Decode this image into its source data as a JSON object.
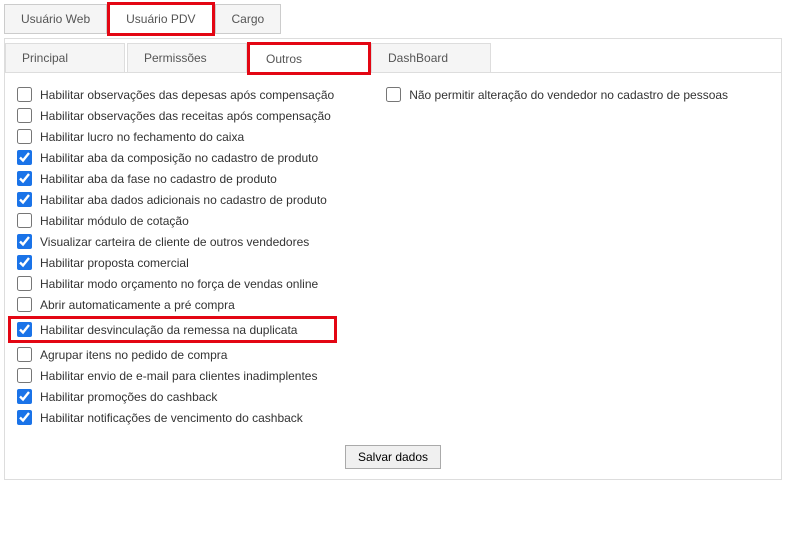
{
  "topTabs": [
    {
      "label": "Usuário Web",
      "active": false,
      "highlight": false
    },
    {
      "label": "Usuário PDV",
      "active": true,
      "highlight": true
    },
    {
      "label": "Cargo",
      "active": false,
      "highlight": false
    }
  ],
  "subTabs": [
    {
      "label": "Principal",
      "active": false,
      "highlight": false
    },
    {
      "label": "Permissões",
      "active": false,
      "highlight": false
    },
    {
      "label": "Outros",
      "active": true,
      "highlight": true
    },
    {
      "label": "DashBoard",
      "active": false,
      "highlight": false
    }
  ],
  "leftOptions": [
    {
      "label": "Habilitar observações das depesas após compensação",
      "checked": false,
      "highlight": false
    },
    {
      "label": "Habilitar observações das receitas após compensação",
      "checked": false,
      "highlight": false
    },
    {
      "label": "Habilitar lucro no fechamento do caixa",
      "checked": false,
      "highlight": false
    },
    {
      "label": "Habilitar aba da composição no cadastro de produto",
      "checked": true,
      "highlight": false
    },
    {
      "label": "Habilitar aba da fase no cadastro de produto",
      "checked": true,
      "highlight": false
    },
    {
      "label": "Habilitar aba dados adicionais no cadastro de produto",
      "checked": true,
      "highlight": false
    },
    {
      "label": "Habilitar módulo de cotação",
      "checked": false,
      "highlight": false
    },
    {
      "label": "Visualizar carteira de cliente de outros vendedores",
      "checked": true,
      "highlight": false
    },
    {
      "label": "Habilitar proposta comercial",
      "checked": true,
      "highlight": false
    },
    {
      "label": "Habilitar modo orçamento no força de vendas online",
      "checked": false,
      "highlight": false
    },
    {
      "label": "Abrir automaticamente a pré compra",
      "checked": false,
      "highlight": false
    },
    {
      "label": "Habilitar desvinculação da remessa na duplicata",
      "checked": true,
      "highlight": true
    },
    {
      "label": "Agrupar itens no pedido de compra",
      "checked": false,
      "highlight": false
    },
    {
      "label": "Habilitar envio de e-mail para clientes inadimplentes",
      "checked": false,
      "highlight": false
    },
    {
      "label": "Habilitar promoções do cashback",
      "checked": true,
      "highlight": false
    },
    {
      "label": "Habilitar notificações de vencimento do cashback",
      "checked": true,
      "highlight": false
    }
  ],
  "rightOptions": [
    {
      "label": "Não permitir alteração do vendedor no cadastro de pessoas",
      "checked": false,
      "highlight": false
    }
  ],
  "saveButton": "Salvar dados"
}
